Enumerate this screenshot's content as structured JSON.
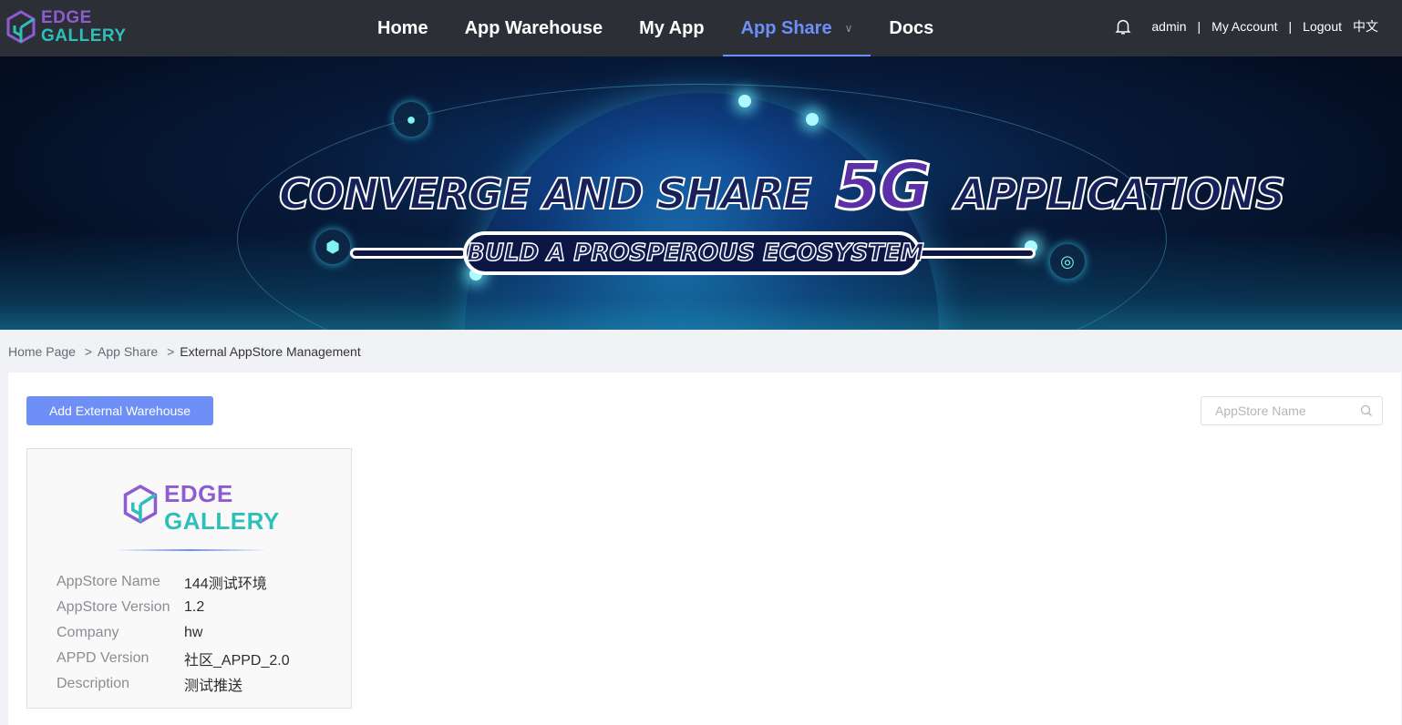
{
  "brand": {
    "line1": "EDGE",
    "line2": "GALLERY"
  },
  "nav": {
    "items": [
      {
        "label": "Home"
      },
      {
        "label": "App Warehouse"
      },
      {
        "label": "My App"
      },
      {
        "label": "App Share"
      },
      {
        "label": "Docs"
      }
    ],
    "active": "App Share"
  },
  "user": {
    "name": "admin",
    "separator": "|",
    "account": "My Account",
    "logout": "Logout",
    "language": "中文"
  },
  "banner": {
    "headline_part1": "CONVERGE AND SHARE",
    "headline_5g": "5G",
    "headline_part2": "APPLICATIONS",
    "subline": "BULD A PROSPEROUS ECOSYSTEM"
  },
  "breadcrumb": {
    "home": "Home Page",
    "sep": ">",
    "section": "App Share",
    "current": "External AppStore Management"
  },
  "toolbar": {
    "add_label": "Add External Warehouse",
    "search_placeholder": "AppStore Name"
  },
  "card": {
    "logo": {
      "line1": "EDGE",
      "line2": "GALLERY"
    },
    "fields": [
      {
        "label": "AppStore Name",
        "value": "144测试环境"
      },
      {
        "label": "AppStore Version",
        "value": "1.2"
      },
      {
        "label": "Company",
        "value": "hw"
      },
      {
        "label": "APPD Version",
        "value": "社区_APPD_2.0"
      },
      {
        "label": "Description",
        "value": "测试推送"
      }
    ]
  },
  "colors": {
    "topbar": "#2d2f36",
    "accent": "#6e8ff5",
    "brand_purple": "#8c5cd0",
    "brand_teal": "#2cc0b9"
  }
}
